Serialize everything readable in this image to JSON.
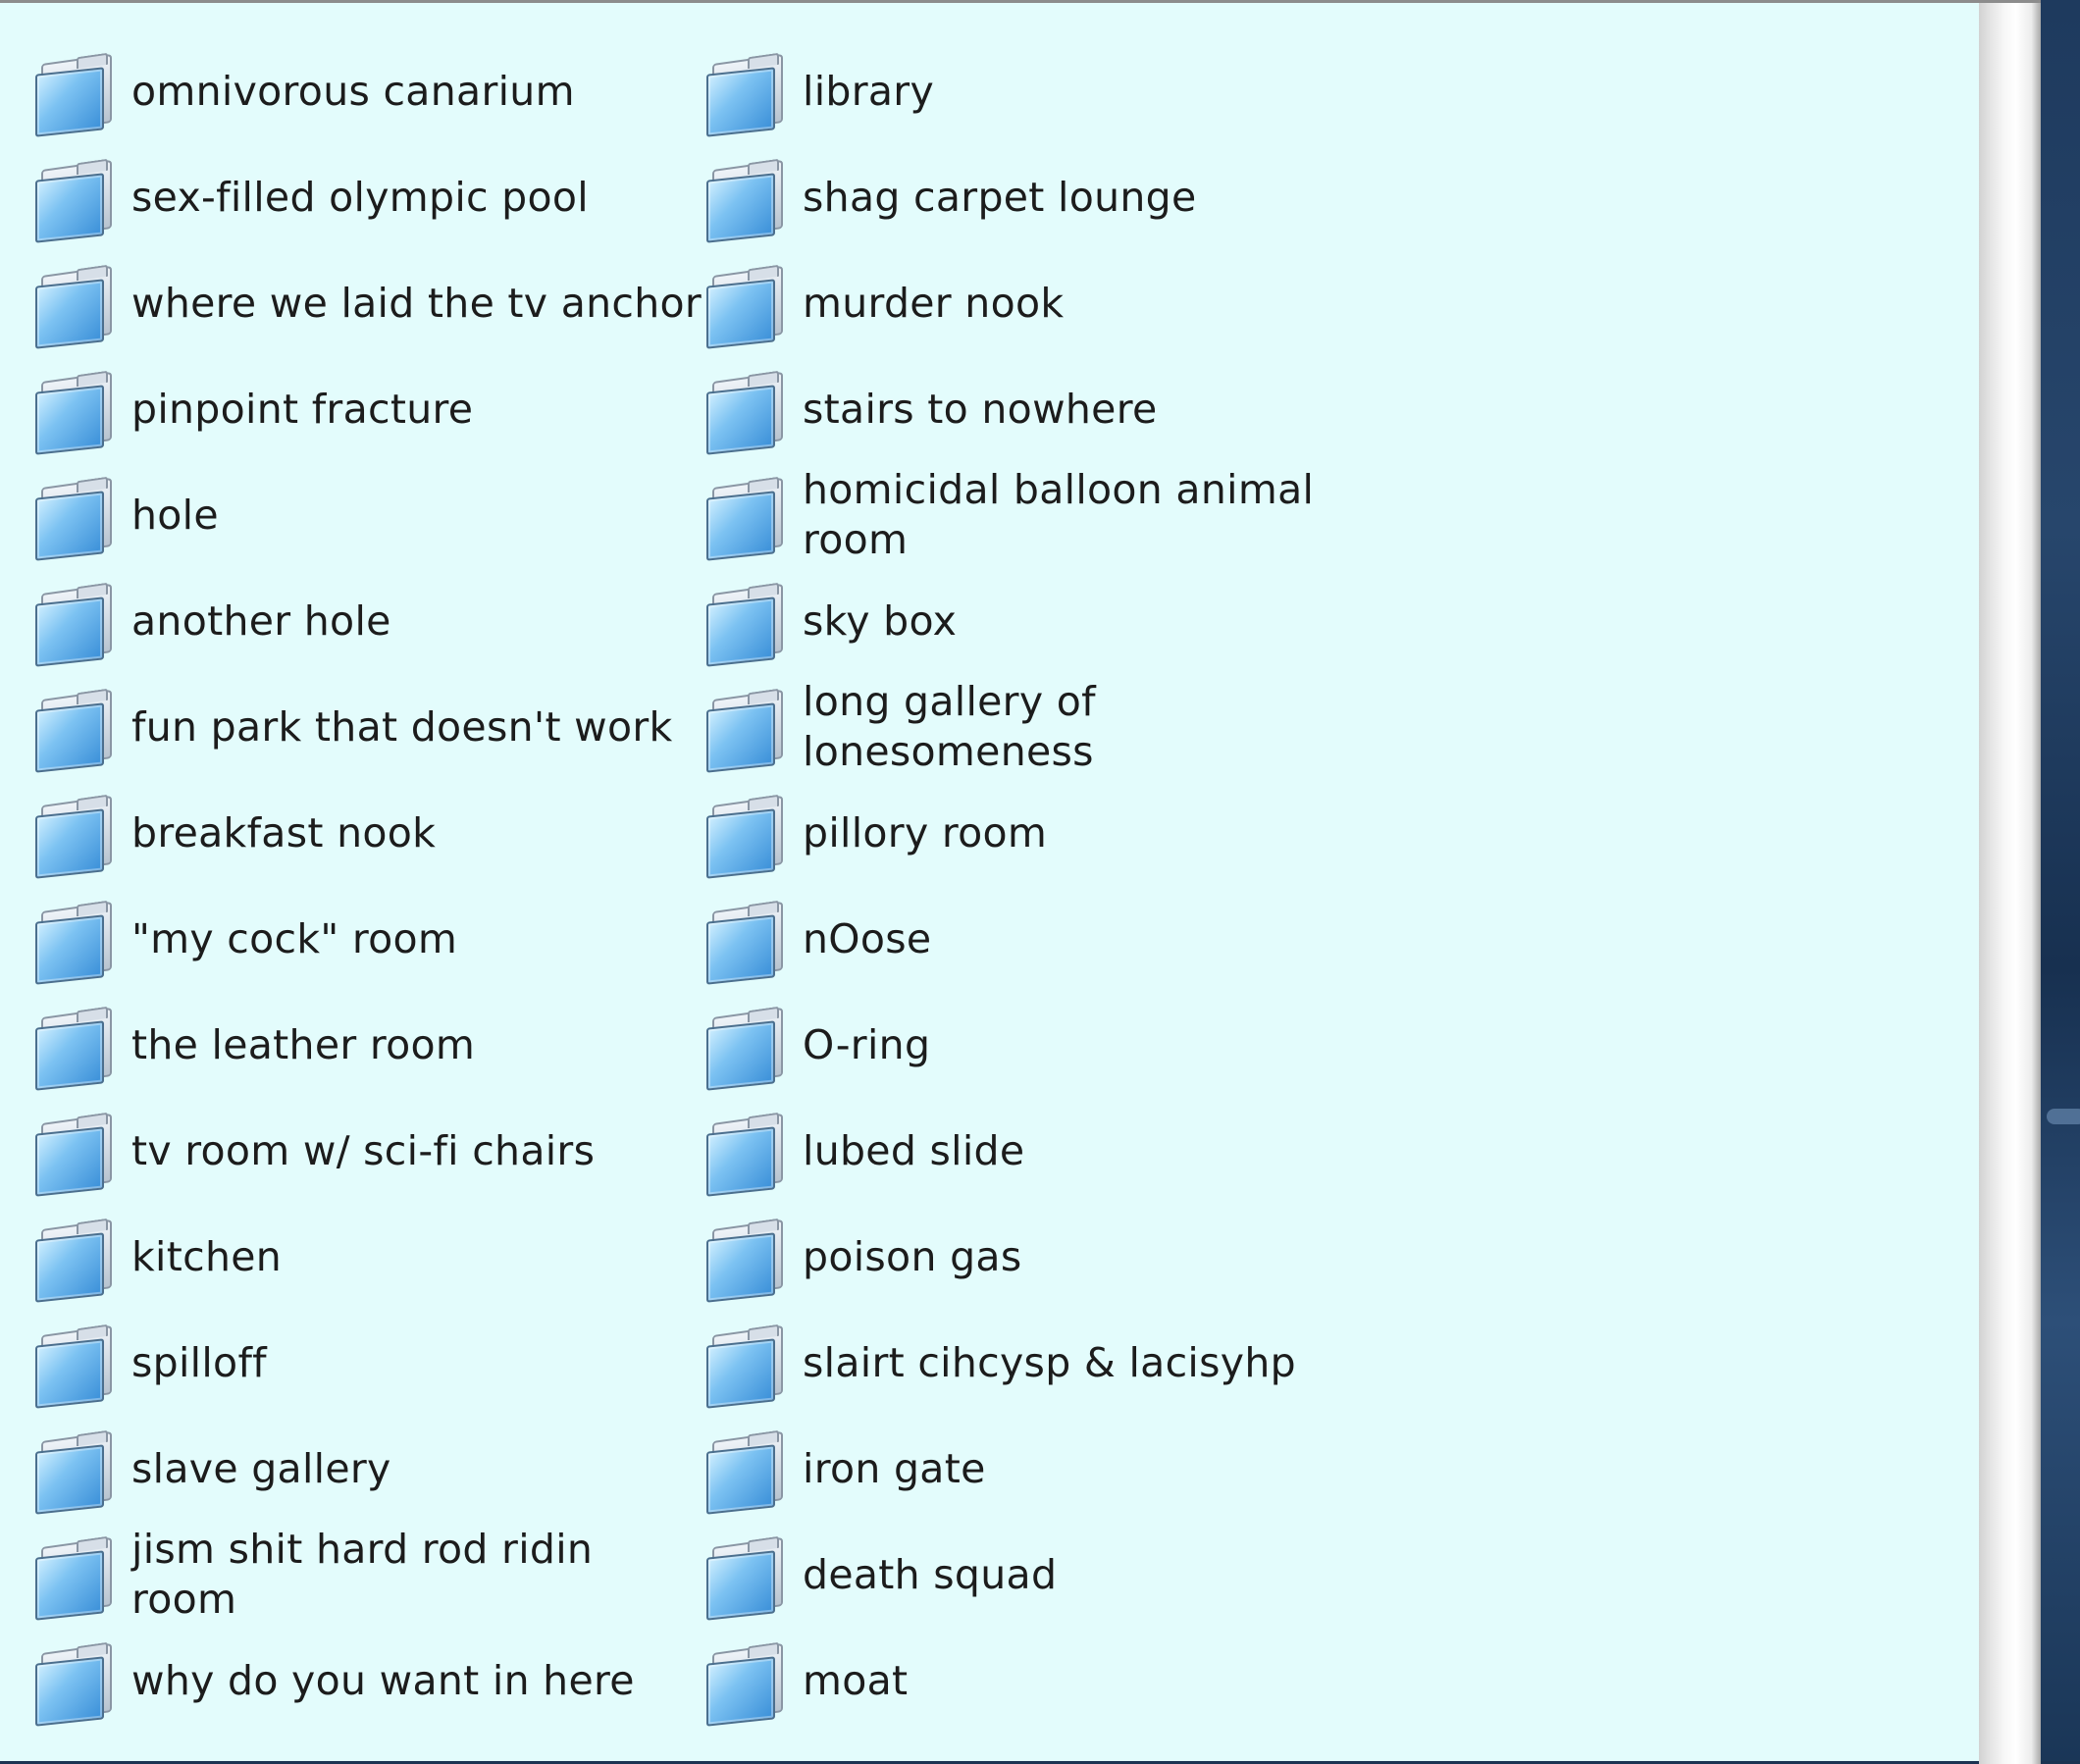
{
  "window": {
    "items": [
      {
        "label": "omnivorous canarium",
        "icon": "folder-icon"
      },
      {
        "label": "sex-filled olympic pool",
        "icon": "folder-icon"
      },
      {
        "label": "where we laid the tv anchor",
        "icon": "folder-icon"
      },
      {
        "label": "pinpoint fracture",
        "icon": "folder-icon"
      },
      {
        "label": "hole",
        "icon": "folder-icon"
      },
      {
        "label": "another hole",
        "icon": "folder-icon"
      },
      {
        "label": "fun park that doesn't work",
        "icon": "folder-icon"
      },
      {
        "label": "breakfast nook",
        "icon": "folder-icon"
      },
      {
        "label": "\"my cock\" room",
        "icon": "folder-icon"
      },
      {
        "label": "the leather room",
        "icon": "folder-icon"
      },
      {
        "label": "tv room w/ sci-fi chairs",
        "icon": "folder-icon"
      },
      {
        "label": "kitchen",
        "icon": "folder-icon"
      },
      {
        "label": "spilloff",
        "icon": "folder-icon"
      },
      {
        "label": "slave gallery",
        "icon": "folder-icon"
      },
      {
        "label": "jism shit hard rod ridin\nroom",
        "icon": "folder-icon"
      },
      {
        "label": "why do you want in here",
        "icon": "folder-icon"
      },
      {
        "label": "library",
        "icon": "folder-icon"
      },
      {
        "label": "shag carpet lounge",
        "icon": "folder-icon"
      },
      {
        "label": "murder nook",
        "icon": "folder-icon"
      },
      {
        "label": "stairs to nowhere",
        "icon": "folder-icon"
      },
      {
        "label": "homicidal balloon animal\nroom",
        "icon": "folder-icon"
      },
      {
        "label": "sky box",
        "icon": "folder-icon"
      },
      {
        "label": "long gallery of\nlonesomeness",
        "icon": "folder-icon"
      },
      {
        "label": "pillory room",
        "icon": "folder-icon"
      },
      {
        "label": "nOose",
        "icon": "folder-icon"
      },
      {
        "label": "O-ring",
        "icon": "folder-icon"
      },
      {
        "label": "lubed slide",
        "icon": "folder-icon"
      },
      {
        "label": "poison gas",
        "icon": "folder-icon"
      },
      {
        "label": "slairt cihcysp & lacisyhp",
        "icon": "folder-icon"
      },
      {
        "label": "iron gate",
        "icon": "folder-icon"
      },
      {
        "label": "death squad",
        "icon": "folder-icon"
      },
      {
        "label": "moat",
        "icon": "folder-icon"
      }
    ]
  },
  "colors": {
    "window_background": "#e3fcfc",
    "label_text": "#1c1c1c",
    "folder_blue": "#5fa9e6"
  }
}
